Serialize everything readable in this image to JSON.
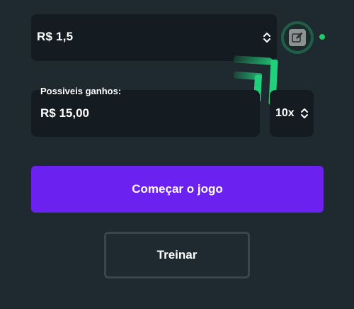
{
  "bet": {
    "value": "R$ 1,5",
    "stepper_icon": "chevron-up-down-icon"
  },
  "edit_button": {
    "icon": "pencil-square-icon"
  },
  "status": {
    "color": "#21c96b"
  },
  "logo": {
    "icon": "green-bars-logo",
    "color": "#21d07a"
  },
  "winnings": {
    "label": "Possiveis ganhos:",
    "value": "R$ 15,00"
  },
  "multiplier": {
    "value": "10x",
    "stepper_icon": "chevron-up-down-icon"
  },
  "actions": {
    "start_label": "Começar o jogo",
    "train_label": "Treinar"
  },
  "colors": {
    "background": "#1f2a30",
    "field": "#141b21",
    "accent": "#6b22f0",
    "success": "#21c96b"
  }
}
